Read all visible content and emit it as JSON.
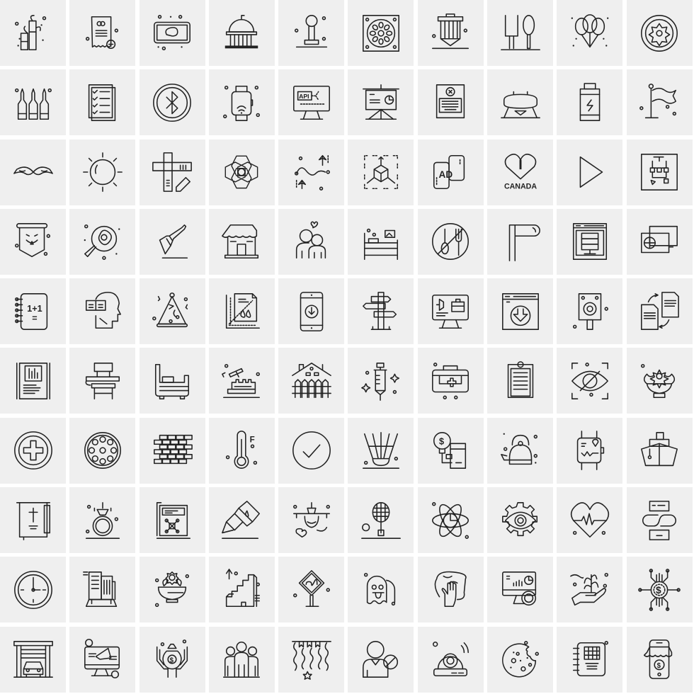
{
  "colors": {
    "tile": "#efefef",
    "gutter": "#ffffff",
    "stroke": "#222222"
  },
  "icons": [
    {
      "name": "bamboo-icon"
    },
    {
      "name": "medical-receipt-icon"
    },
    {
      "name": "meat-tablet-icon"
    },
    {
      "name": "capitol-building-icon"
    },
    {
      "name": "joystick-icon"
    },
    {
      "name": "dartboard-tile-icon"
    },
    {
      "name": "3d-printer-nozzle-icon"
    },
    {
      "name": "fork-spoon-icon"
    },
    {
      "name": "balloons-icon"
    },
    {
      "name": "flower-plate-icon"
    },
    {
      "name": "ampoules-icon"
    },
    {
      "name": "checklist-icon"
    },
    {
      "name": "bluetooth-icon"
    },
    {
      "name": "smartwatch-wifi-icon"
    },
    {
      "name": "api-monitor-icon"
    },
    {
      "name": "presentation-board-icon"
    },
    {
      "name": "laptop-error-icon"
    },
    {
      "name": "pommel-horse-icon"
    },
    {
      "name": "battery-icon"
    },
    {
      "name": "flag-pole-icon"
    },
    {
      "name": "mustache-icon"
    },
    {
      "name": "sun-icon"
    },
    {
      "name": "ruler-pencil-icon"
    },
    {
      "name": "geometric-flower-icon"
    },
    {
      "name": "route-navigation-icon"
    },
    {
      "name": "3d-cube-expand-icon"
    },
    {
      "name": "mobile-ad-icon"
    },
    {
      "name": "i-love-canada-icon",
      "label": "I",
      "caption": "CANADA"
    },
    {
      "name": "play-icon"
    },
    {
      "name": "flowchart-icon"
    },
    {
      "name": "halloween-banner-icon"
    },
    {
      "name": "frying-egg-icon"
    },
    {
      "name": "revolver-icon"
    },
    {
      "name": "shop-front-icon"
    },
    {
      "name": "couple-love-icon"
    },
    {
      "name": "bunk-bed-icon"
    },
    {
      "name": "no-food-icon"
    },
    {
      "name": "flag-icon"
    },
    {
      "name": "server-web-icon"
    },
    {
      "name": "global-card-icon"
    },
    {
      "name": "math-notebook-icon",
      "label": "1+1",
      "label2": "="
    },
    {
      "name": "mind-book-icon"
    },
    {
      "name": "party-hat-icon"
    },
    {
      "name": "document-ruler-icon"
    },
    {
      "name": "mobile-download-icon"
    },
    {
      "name": "signpost-icon"
    },
    {
      "name": "online-job-icon"
    },
    {
      "name": "browser-download-icon"
    },
    {
      "name": "speaker-icon"
    },
    {
      "name": "document-exchange-icon"
    },
    {
      "name": "document-chart-icon"
    },
    {
      "name": "school-desk-icon"
    },
    {
      "name": "bed-icon"
    },
    {
      "name": "auction-icon"
    },
    {
      "name": "house-fence-icon"
    },
    {
      "name": "syringe-icon"
    },
    {
      "name": "first-aid-kit-icon"
    },
    {
      "name": "clipboard-icon"
    },
    {
      "name": "hidden-eye-icon"
    },
    {
      "name": "flower-bowl-icon"
    },
    {
      "name": "medical-cross-icon"
    },
    {
      "name": "drain-icon"
    },
    {
      "name": "brick-wall-icon"
    },
    {
      "name": "thermometer-icon",
      "label": "F"
    },
    {
      "name": "check-circle-icon"
    },
    {
      "name": "shuttlecock-icon"
    },
    {
      "name": "idea-mobile-charge-icon"
    },
    {
      "name": "kettle-icon"
    },
    {
      "name": "smartwatch-health-icon"
    },
    {
      "name": "ship-icon"
    },
    {
      "name": "bible-icon"
    },
    {
      "name": "diamond-ring-icon"
    },
    {
      "name": "video-layout-icon"
    },
    {
      "name": "glue-icon"
    },
    {
      "name": "airplane-love-icon"
    },
    {
      "name": "badminton-racket-icon"
    },
    {
      "name": "atom-chart-icon"
    },
    {
      "name": "eye-gear-icon"
    },
    {
      "name": "heartbeat-icon"
    },
    {
      "name": "mobile-link-icon"
    },
    {
      "name": "wall-clock-icon"
    },
    {
      "name": "city-buildings-icon"
    },
    {
      "name": "salad-bowl-icon"
    },
    {
      "name": "stairs-up-icon"
    },
    {
      "name": "road-sign-icon"
    },
    {
      "name": "ghost-icon"
    },
    {
      "name": "cleaning-hand-icon"
    },
    {
      "name": "monitor-finance-icon"
    },
    {
      "name": "plant-hand-icon"
    },
    {
      "name": "digital-dollar-icon"
    },
    {
      "name": "garage-car-icon"
    },
    {
      "name": "social-marketing-icon"
    },
    {
      "name": "money-bag-hands-icon"
    },
    {
      "name": "group-people-icon"
    },
    {
      "name": "party-streamers-icon"
    },
    {
      "name": "blocked-user-icon"
    },
    {
      "name": "robot-vacuum-icon"
    },
    {
      "name": "cookie-icon"
    },
    {
      "name": "notebook-grid-icon"
    },
    {
      "name": "mobile-shop-icon"
    }
  ]
}
